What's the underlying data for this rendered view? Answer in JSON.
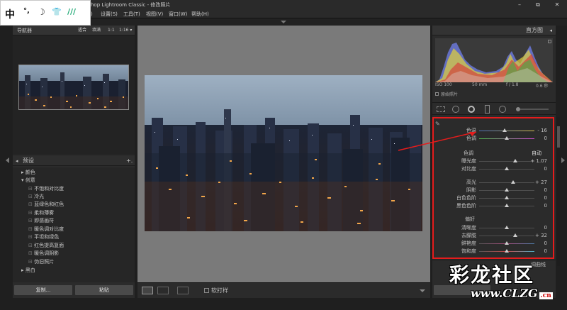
{
  "window": {
    "title": "hop Lightroom Classic - 修改照片",
    "controls": [
      "–",
      "⧉",
      "✕"
    ]
  },
  "ime": {
    "chars": [
      "中",
      "°,",
      "☽",
      "👕",
      "///"
    ]
  },
  "menu": {
    "items": [
      "设置(S)",
      "工具(T)",
      "视图(V)",
      "窗口(W)",
      "帮助(H)"
    ]
  },
  "navigator": {
    "title": "导航器",
    "options": [
      "适合",
      "填满",
      "1:1",
      "1:16 ▾"
    ]
  },
  "presets": {
    "title": "预设",
    "add": "+.",
    "items": [
      {
        "label": "颜色",
        "type": "folder"
      },
      {
        "label": "创意",
        "type": "folder-open"
      },
      {
        "label": "不饱和对比度",
        "type": "item"
      },
      {
        "label": "冷光",
        "type": "item"
      },
      {
        "label": "蓝绿色和红色",
        "type": "item"
      },
      {
        "label": "柔和薄雾",
        "type": "item"
      },
      {
        "label": "即感画符",
        "type": "item"
      },
      {
        "label": "暖色调对比度",
        "type": "item"
      },
      {
        "label": "平坦和绿色",
        "type": "item"
      },
      {
        "label": "红色提高复面",
        "type": "item"
      },
      {
        "label": "暖色调阴影",
        "type": "item"
      },
      {
        "label": "伪旧照片",
        "type": "item"
      },
      {
        "label": "黑白",
        "type": "folder"
      }
    ]
  },
  "left_buttons": {
    "copy": "复制...",
    "paste": "粘贴"
  },
  "toolbar": {
    "soft_proof": "软打样"
  },
  "histogram": {
    "title": "直方图",
    "info": [
      "ISO 100",
      "50 mm",
      "f / 1.8",
      "0.6 秒"
    ],
    "original_photo": "原始照片"
  },
  "basic": {
    "wb_sliders": [
      {
        "label": "色温",
        "value": "- 16",
        "pos": 0.46
      },
      {
        "label": "色调",
        "value": "0",
        "pos": 0.5
      }
    ],
    "tone_title": "色调",
    "tone_auto": "自动",
    "tone_sliders": [
      {
        "label": "曝光度",
        "value": "+ 1.07",
        "pos": 0.65
      },
      {
        "label": "对比度",
        "value": "0",
        "pos": 0.5
      }
    ],
    "tone2_sliders": [
      {
        "label": "高光",
        "value": "+ 27",
        "pos": 0.62
      },
      {
        "label": "阴影",
        "value": "0",
        "pos": 0.5
      },
      {
        "label": "白色色阶",
        "value": "0",
        "pos": 0.5
      },
      {
        "label": "黑色色阶",
        "value": "0",
        "pos": 0.5
      }
    ],
    "presence_title": "偏好",
    "presence_sliders": [
      {
        "label": "清晰度",
        "value": "0",
        "pos": 0.5
      },
      {
        "label": "去朦胧",
        "value": "+ 32",
        "pos": 0.66
      },
      {
        "label": "鲜艳度",
        "value": "0",
        "pos": 0.5
      },
      {
        "label": "饱和度",
        "value": "0",
        "pos": 0.5
      }
    ],
    "bottom_label": "调曲线"
  },
  "watermark": {
    "line1": "彩龙社区",
    "line2": "www.CLZG",
    "suffix": ".cn"
  }
}
